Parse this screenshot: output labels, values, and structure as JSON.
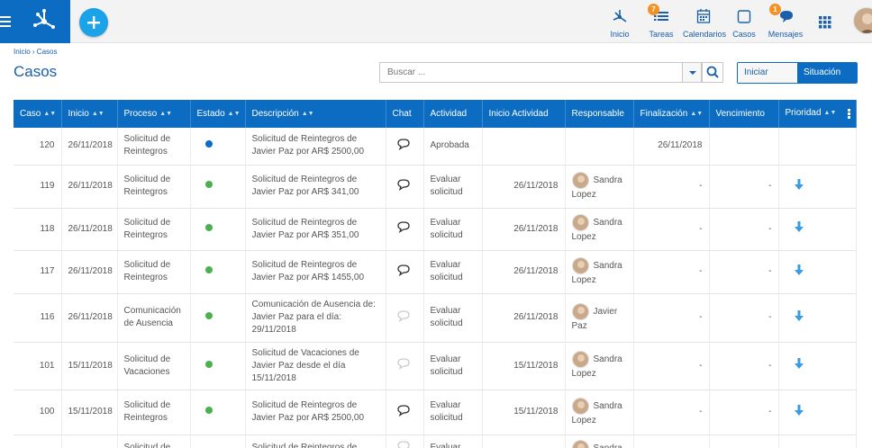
{
  "topbar": {
    "nav": [
      {
        "key": "inicio",
        "label": "Inicio",
        "icon": "workflow-icon"
      },
      {
        "key": "tareas",
        "label": "Tareas",
        "icon": "tasks-icon",
        "badge": "7"
      },
      {
        "key": "calendarios",
        "label": "Calendarios",
        "icon": "calendar-icon"
      },
      {
        "key": "casos",
        "label": "Casos",
        "icon": "cases-icon"
      },
      {
        "key": "mensajes",
        "label": "Mensajes",
        "icon": "chat-icon",
        "badge": "1"
      }
    ]
  },
  "breadcrumb": "Inicio › Casos",
  "page_title": "Casos",
  "search": {
    "placeholder": "Buscar ..."
  },
  "toggle": {
    "start_case": "Iniciar Caso",
    "situation": "Situación"
  },
  "table": {
    "columns": [
      "Caso",
      "Inicio",
      "Proceso",
      "Estado",
      "Descripción",
      "Chat",
      "Actividad",
      "Inicio Actividad",
      "Responsable",
      "Finalización",
      "Vencimiento",
      "Prioridad"
    ],
    "status_colors": {
      "blue": "#0b6cc2",
      "green": "#4caf50"
    },
    "rows": [
      {
        "caso": "120",
        "inicio": "26/11/2018",
        "proceso": "Solicitud de Reintegros",
        "estado": "blue",
        "descripcion": "Solicitud de Reintegros de Javier Paz por AR$ 2500,00",
        "chat": "active",
        "actividad": "Aprobada",
        "inicio_actividad": "",
        "responsable": "",
        "finalizacion": "26/11/2018",
        "vencimiento": "",
        "prioridad": ""
      },
      {
        "caso": "119",
        "inicio": "26/11/2018",
        "proceso": "Solicitud de Reintegros",
        "estado": "green",
        "descripcion": "Solicitud de Reintegros de Javier Paz por AR$ 341,00",
        "chat": "active",
        "actividad": "Evaluar solicitud",
        "inicio_actividad": "26/11/2018",
        "responsable": "Sandra Lopez",
        "finalizacion": "-",
        "vencimiento": "-",
        "prioridad": "down"
      },
      {
        "caso": "118",
        "inicio": "26/11/2018",
        "proceso": "Solicitud de Reintegros",
        "estado": "green",
        "descripcion": "Solicitud de Reintegros de Javier Paz por AR$ 351,00",
        "chat": "active",
        "actividad": "Evaluar solicitud",
        "inicio_actividad": "26/11/2018",
        "responsable": "Sandra Lopez",
        "finalizacion": "-",
        "vencimiento": "-",
        "prioridad": "down"
      },
      {
        "caso": "117",
        "inicio": "26/11/2018",
        "proceso": "Solicitud de Reintegros",
        "estado": "green",
        "descripcion": "Solicitud de Reintegros de Javier Paz por AR$ 1455,00",
        "chat": "active",
        "actividad": "Evaluar solicitud",
        "inicio_actividad": "26/11/2018",
        "responsable": "Sandra Lopez",
        "finalizacion": "-",
        "vencimiento": "-",
        "prioridad": "down"
      },
      {
        "caso": "116",
        "inicio": "26/11/2018",
        "proceso": "Comunicación de Ausencia",
        "estado": "green",
        "descripcion": "Comunicación de Ausencia de: Javier Paz para el día: 29/11/2018",
        "chat": "inactive",
        "actividad": "Evaluar solicitud",
        "inicio_actividad": "26/11/2018",
        "responsable": "Javier Paz",
        "finalizacion": "-",
        "vencimiento": "-",
        "prioridad": "down"
      },
      {
        "caso": "101",
        "inicio": "15/11/2018",
        "proceso": "Solicitud de Vacaciones",
        "estado": "green",
        "descripcion": "Solicitud de Vacaciones de Javier Paz desde el día 15/11/2018",
        "chat": "inactive",
        "actividad": "Evaluar solicitud",
        "inicio_actividad": "15/11/2018",
        "responsable": "Sandra Lopez",
        "finalizacion": "-",
        "vencimiento": "-",
        "prioridad": "down"
      },
      {
        "caso": "100",
        "inicio": "15/11/2018",
        "proceso": "Solicitud de Reintegros",
        "estado": "green",
        "descripcion": "Solicitud de Reintegros de Javier Paz por AR$ 2500,00",
        "chat": "active",
        "actividad": "Evaluar solicitud",
        "inicio_actividad": "15/11/2018",
        "responsable": "Sandra Lopez",
        "finalizacion": "-",
        "vencimiento": "-",
        "prioridad": "down"
      },
      {
        "caso": "",
        "inicio": "",
        "proceso": "Solicitud de",
        "estado": "",
        "descripcion": "Solicitud de Reintegros de",
        "chat": "inactive",
        "actividad": "Evaluar",
        "inicio_actividad": "",
        "responsable": "Sandra",
        "finalizacion": "",
        "vencimiento": "",
        "prioridad": ""
      }
    ]
  }
}
